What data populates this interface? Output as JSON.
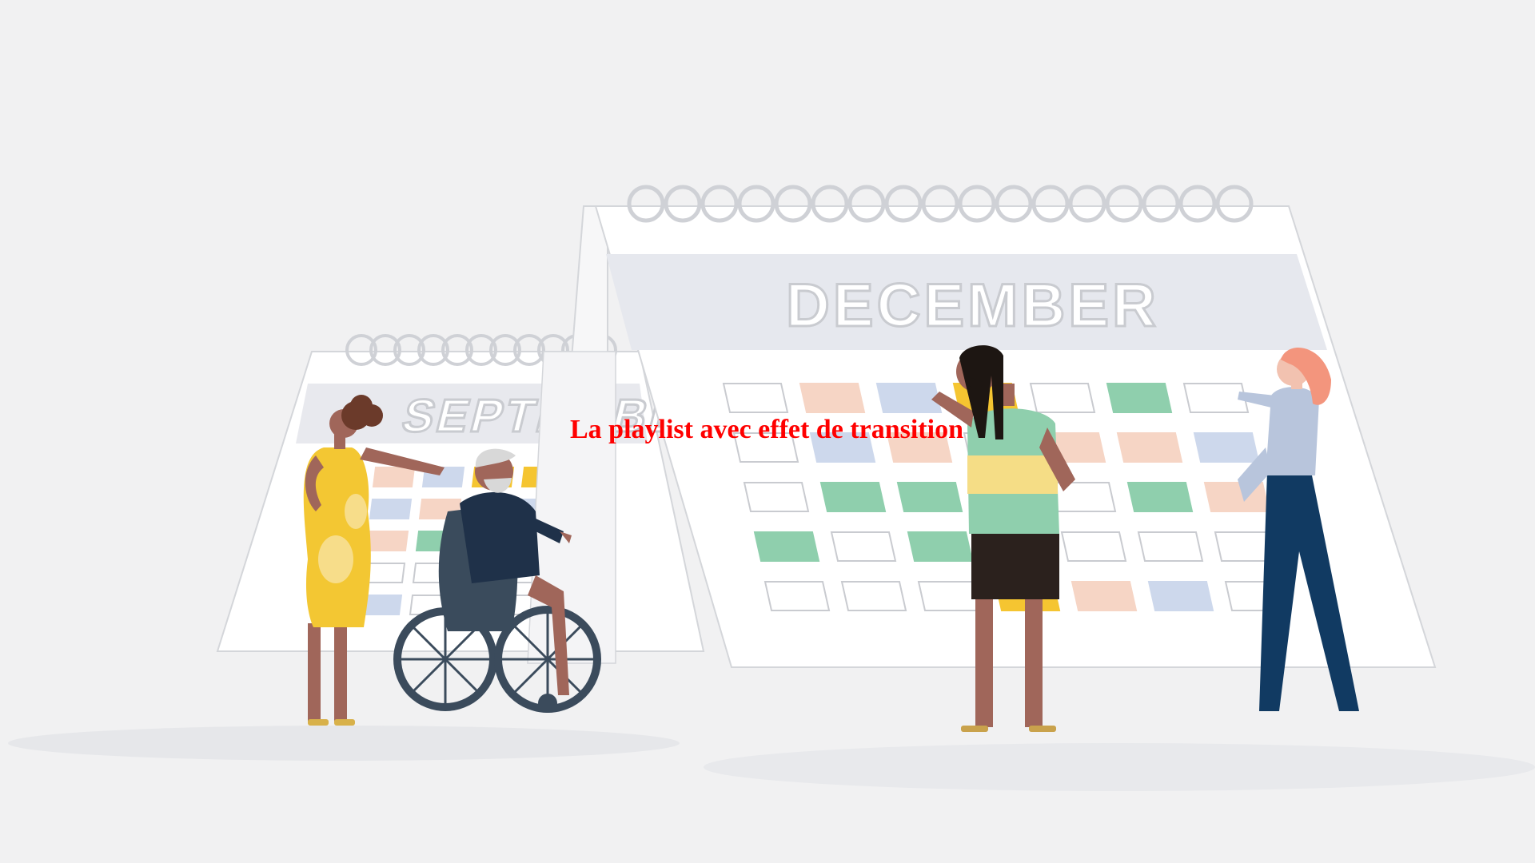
{
  "caption": {
    "text": "La playlist avec effet de transition",
    "color": "#ff0000"
  },
  "calendars": {
    "back": {
      "month": "SEPTEMBER"
    },
    "front": {
      "month": "DECEMBER"
    }
  },
  "palette": {
    "background": "#f1f1f2",
    "salmon": "#f6d5c5",
    "green": "#8fcfad",
    "blue": "#cdd8ec",
    "yellow": "#f5c531",
    "outline": "#c9cbd0"
  },
  "people": [
    "woman-yellow-dress",
    "man-in-wheelchair",
    "man-green-striped-shirt",
    "woman-red-hair"
  ]
}
